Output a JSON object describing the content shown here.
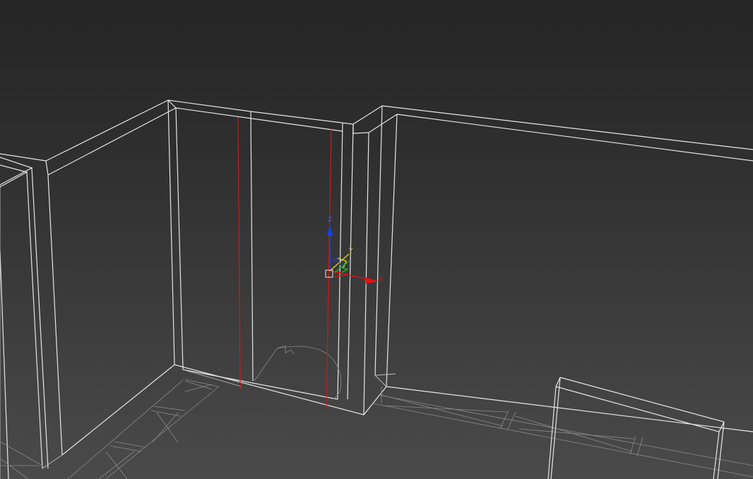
{
  "viewport": {
    "name": "3d-perspective-viewport",
    "render_mode": "wireframe",
    "background": {
      "top": "#252525",
      "bottom": "#4a4a4a"
    },
    "colors": {
      "wireframe": "#e6e6e6",
      "selected_edge": "#d01818",
      "gizmo_x": "#e01010",
      "gizmo_y": "#e0d020",
      "gizmo_z": "#1840e0",
      "gizmo_xy_plane": "#20c020"
    }
  },
  "gizmo": {
    "type": "move-transform-gizmo",
    "axes": {
      "x": "X",
      "y": "Y",
      "z": "Z"
    }
  }
}
